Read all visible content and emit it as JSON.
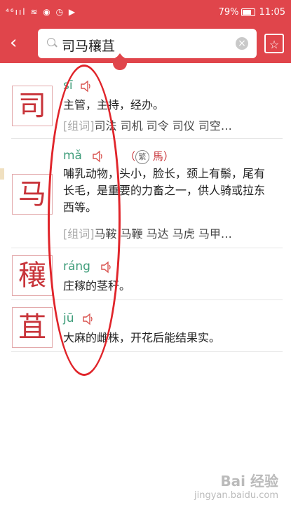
{
  "status": {
    "left": "⁴⁶ııl ≋ ◉ ◷ ▶",
    "battery": "79%",
    "time": "11:05"
  },
  "search": {
    "query": "司马穰苴"
  },
  "entries": [
    {
      "char": "司",
      "pinyin": "sī",
      "def": "主管，主持，经办。",
      "cizu_tag": "[组词]",
      "cizu": "司法 司机 司令 司仪 司空…"
    },
    {
      "char": "马",
      "pinyin": "mǎ",
      "trad_mark": "繁",
      "trad": "馬",
      "def": "哺乳动物，头小，脸长，颈上有鬃，尾有长毛，是重要的力畜之一，供人骑或拉东西等。",
      "cizu_tag": "[组词]",
      "cizu": "马鞍 马鞭 马达 马虎 马甲…"
    },
    {
      "char": "穰",
      "pinyin": "ráng",
      "def": "庄稼的茎秆。"
    },
    {
      "char": "苴",
      "pinyin": "jū",
      "def": "大麻的雌株，开花后能结果实。"
    }
  ],
  "watermark": {
    "line1": "Bai 经验",
    "line2": "jingyan.baidu.com"
  }
}
